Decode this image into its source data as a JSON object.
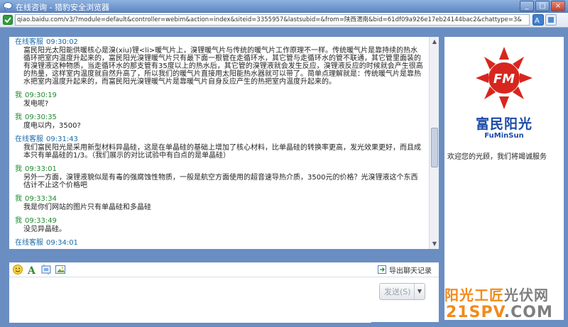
{
  "window": {
    "title": "在线咨询 - 猎豹安全浏览器",
    "controls": [
      "_",
      "□",
      "×"
    ]
  },
  "address_bar": {
    "url": "qiao.baidu.com/v3/?module=default&controller=webim&action=index&siteid=3355957&lastsubid=&from=陕西渭南&bid=61df09a926e17eb24144bac2&chattype=3&"
  },
  "messages": [
    {
      "sender": "在线客服",
      "time": "09:30:02",
      "role": "agent",
      "text": "富民阳光太阳能供暖核心是溴(xiu)锂<li>暖气片上，溴锂暖气片与传统的暖气片工作原理不一样。传统暖气片是靠持续的热水循环把室内温度升起来的，富民阳光溴锂暖气片只有最下面一根管在走循环水，其它管与走循环水的管不联通，其它管里面装的有溴锂液这种物质，当走循环水的那支管有35度以上的热水后，其它管的溴锂液就会发生反应，溴锂液反应的时候就会产生很高的热量，这样室内温度就自然升高了，所以我们的暖气片直接用太阳能热水器就可以带了。简单点理解就是：传统暖气片是靠热水把室内温度升起来的，而富民阳光溴锂暖气片是靠暖气片自身反应产生的热把室内温度升起来的。"
    },
    {
      "sender": "我",
      "time": "09:30:19",
      "role": "user",
      "text": "发电呢?"
    },
    {
      "sender": "我",
      "time": "09:30:35",
      "role": "user",
      "text": "度电以内，3500?"
    },
    {
      "sender": "在线客服",
      "time": "09:31:43",
      "role": "agent",
      "text": "我们富民阳光是采用新型材料异晶硅，这是在单晶硅的基础上增加了核心材料，比单晶硅的转换率更高，发光效果更好，而且成本只有单晶硅的1/3。（我们展示的对比试验中有白点的是单晶硅）"
    },
    {
      "sender": "我",
      "time": "09:33:01",
      "role": "user",
      "text": "另外一方面，溴锂液貌似是有毒的强腐蚀性物质，一般是航空方面使用的超音速导热介质，3500元的价格？光溴锂液这个东西估计不止这个价格吧"
    },
    {
      "sender": "我",
      "time": "09:33:34",
      "role": "user",
      "text": "我是你们网站的图片只有单晶硅和多晶硅"
    },
    {
      "sender": "我",
      "time": "09:33:49",
      "role": "user",
      "text": "没见异晶硅。"
    },
    {
      "sender": "在线客服",
      "time": "09:34:01",
      "role": "agent",
      "text": ""
    }
  ],
  "toolbar": {
    "icons": [
      "smiley-icon",
      "font-icon",
      "screenshot-icon",
      "image-icon"
    ],
    "export_label": "导出聊天记录"
  },
  "input": {
    "value": ""
  },
  "send_button": {
    "label": "发送(S)"
  },
  "side_panel": {
    "logo_mark": "FM",
    "logo_cn": "富民阳光",
    "logo_en": "FuMinSun",
    "welcome": "欢迎您的光顾，我们将竭诚服务"
  },
  "watermark": {
    "line1_orange": "阳光工匠",
    "line1_gray": "光伏网",
    "line2_orange": "21SPV",
    "line2_gray": ".COM"
  },
  "colors": {
    "agent_header": "#1a6aa8",
    "user_header": "#1e8b2f",
    "brand_red": "#d7261e",
    "brand_blue": "#1c4aa8",
    "watermark_orange": "#f28a1a"
  }
}
